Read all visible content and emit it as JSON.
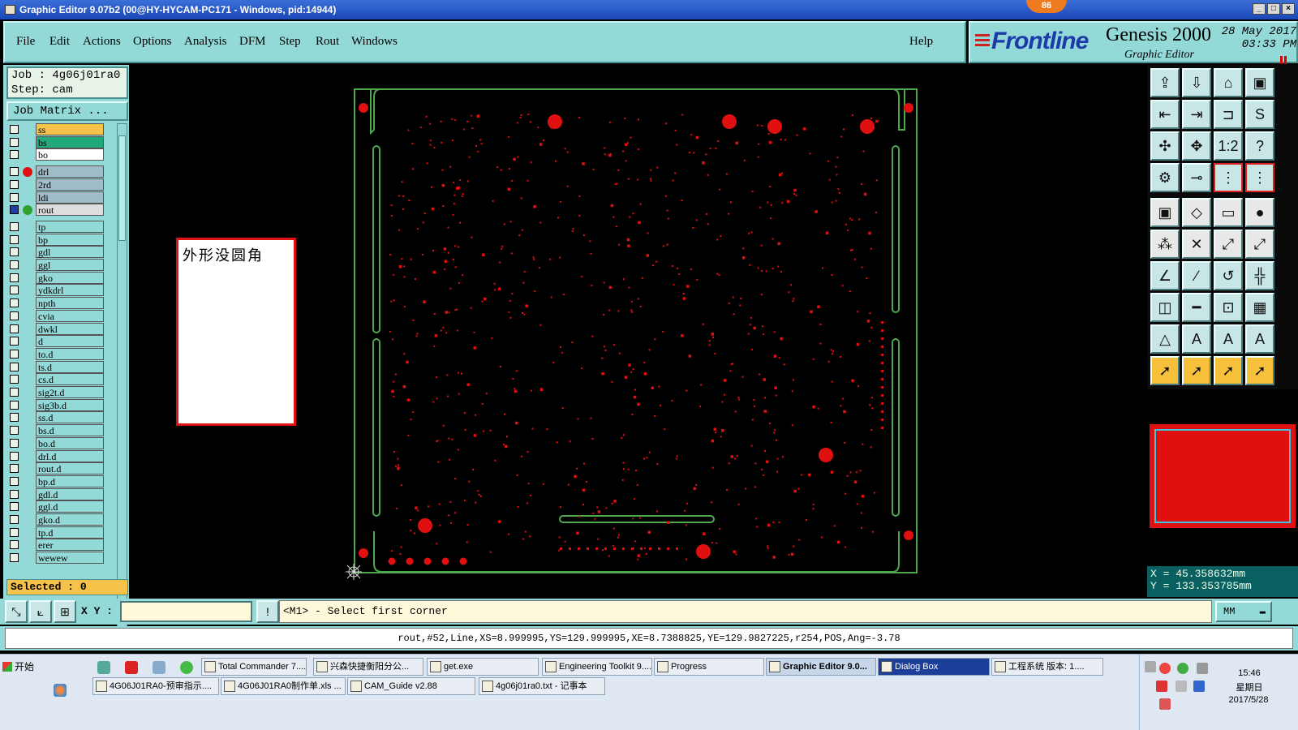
{
  "window": {
    "title": "Graphic Editor 9.07b2 (00@HY-HYCAM-PC171 - Windows, pid:14944)",
    "badge": "86"
  },
  "menu": {
    "items": [
      "File",
      "Edit",
      "Actions",
      "Options",
      "Analysis",
      "DFM",
      "Step",
      "Rout",
      "Windows"
    ],
    "help": "Help"
  },
  "logo": {
    "brand": "Frontline",
    "product": "Genesis 2000",
    "subtitle": "Graphic Editor",
    "date": "28 May 2017",
    "time": "03:33 PM"
  },
  "job": {
    "job_line": "Job : 4g06j01ra0",
    "step_line": "Step: cam",
    "matrix_label": "Job Matrix ..."
  },
  "layers": [
    {
      "name": "ss",
      "color": "#f7c24a",
      "dot": ""
    },
    {
      "name": "bs",
      "color": "#22a87a",
      "dot": ""
    },
    {
      "name": "bo",
      "color": "#ffffff",
      "dot": ""
    },
    {
      "name": "drl",
      "color": "#9fbcc8",
      "dot": "#e01010"
    },
    {
      "name": "2rd",
      "color": "#9fbcc8",
      "dot": ""
    },
    {
      "name": "ldi",
      "color": "#9fbcc8",
      "dot": ""
    },
    {
      "name": "rout",
      "color": "#dddddd",
      "dot": "#30a030",
      "checked": true
    },
    {
      "name": "tp",
      "color": "#93d9d8",
      "dot": ""
    },
    {
      "name": "bp",
      "color": "#93d9d8",
      "dot": ""
    },
    {
      "name": "gdl",
      "color": "#93d9d8",
      "dot": ""
    },
    {
      "name": "ggl",
      "color": "#93d9d8",
      "dot": ""
    },
    {
      "name": "gko",
      "color": "#93d9d8",
      "dot": ""
    },
    {
      "name": "ydkdrl",
      "color": "#93d9d8",
      "dot": ""
    },
    {
      "name": "npth",
      "color": "#93d9d8",
      "dot": ""
    },
    {
      "name": "cvia",
      "color": "#93d9d8",
      "dot": ""
    },
    {
      "name": "dwkl",
      "color": "#93d9d8",
      "dot": ""
    },
    {
      "name": "d",
      "color": "#93d9d8",
      "dot": ""
    },
    {
      "name": "to.d",
      "color": "#93d9d8",
      "dot": ""
    },
    {
      "name": "ts.d",
      "color": "#93d9d8",
      "dot": ""
    },
    {
      "name": "cs.d",
      "color": "#93d9d8",
      "dot": ""
    },
    {
      "name": "sig2t.d",
      "color": "#93d9d8",
      "dot": ""
    },
    {
      "name": "sig3b.d",
      "color": "#93d9d8",
      "dot": ""
    },
    {
      "name": "ss.d",
      "color": "#93d9d8",
      "dot": ""
    },
    {
      "name": "bs.d",
      "color": "#93d9d8",
      "dot": ""
    },
    {
      "name": "bo.d",
      "color": "#93d9d8",
      "dot": ""
    },
    {
      "name": "drl.d",
      "color": "#93d9d8",
      "dot": ""
    },
    {
      "name": "rout.d",
      "color": "#93d9d8",
      "dot": ""
    },
    {
      "name": "bp.d",
      "color": "#93d9d8",
      "dot": ""
    },
    {
      "name": "gdl.d",
      "color": "#93d9d8",
      "dot": ""
    },
    {
      "name": "ggl.d",
      "color": "#93d9d8",
      "dot": ""
    },
    {
      "name": "gko.d",
      "color": "#93d9d8",
      "dot": ""
    },
    {
      "name": "tp.d",
      "color": "#93d9d8",
      "dot": ""
    },
    {
      "name": "erer",
      "color": "#93d9d8",
      "dot": ""
    },
    {
      "name": "wewew",
      "color": "#93d9d8",
      "dot": ""
    }
  ],
  "selected": "Selected : 0",
  "note": {
    "text": "外形没圆角"
  },
  "coords": {
    "x": "X = 45.358632mm",
    "y": "Y = 133.353785mm"
  },
  "command": {
    "xy_label": "X Y :",
    "prompt": "<M1> - Select first corner",
    "unit": "MM"
  },
  "status": "rout,#52,Line,XS=8.999995,YS=129.999995,XE=8.7388825,YE=129.9827225,r254,POS,Ang=-3.78",
  "taskbar": {
    "start": "开始",
    "row1": [
      {
        "label": "Total Commander 7....",
        "icon": "floppy-icon"
      },
      {
        "label": "兴森快捷衡阳分公...",
        "icon": "star-icon"
      },
      {
        "label": "get.exe",
        "icon": "globe-icon"
      },
      {
        "label": "Engineering Toolkit 9....",
        "icon": "app-icon"
      },
      {
        "label": "Progress",
        "icon": "app-icon"
      },
      {
        "label": "Graphic Editor 9.0...",
        "icon": "app-icon",
        "active": true
      },
      {
        "label": "Dialog Box",
        "icon": "app-icon",
        "dialog": true
      },
      {
        "label": "工程系统  版本: 1....",
        "icon": "p-icon"
      }
    ],
    "row2": [
      {
        "label": "4G06J01RA0-预审指示....",
        "icon": "doc-icon"
      },
      {
        "label": "4G06J01RA0制作单.xls ...",
        "icon": "doc-icon"
      },
      {
        "label": "CAM_Guide v2.88",
        "icon": "gear-icon"
      },
      {
        "label": "4g06j01ra0.txt - 记事本",
        "icon": "notepad-icon"
      }
    ],
    "clock": "15:46",
    "weekday": "星期日",
    "date": "2017/5/28"
  },
  "colors": {
    "panel": "#93d9d8",
    "pcb_red": "#e01010",
    "outline": "#4ea84e"
  }
}
